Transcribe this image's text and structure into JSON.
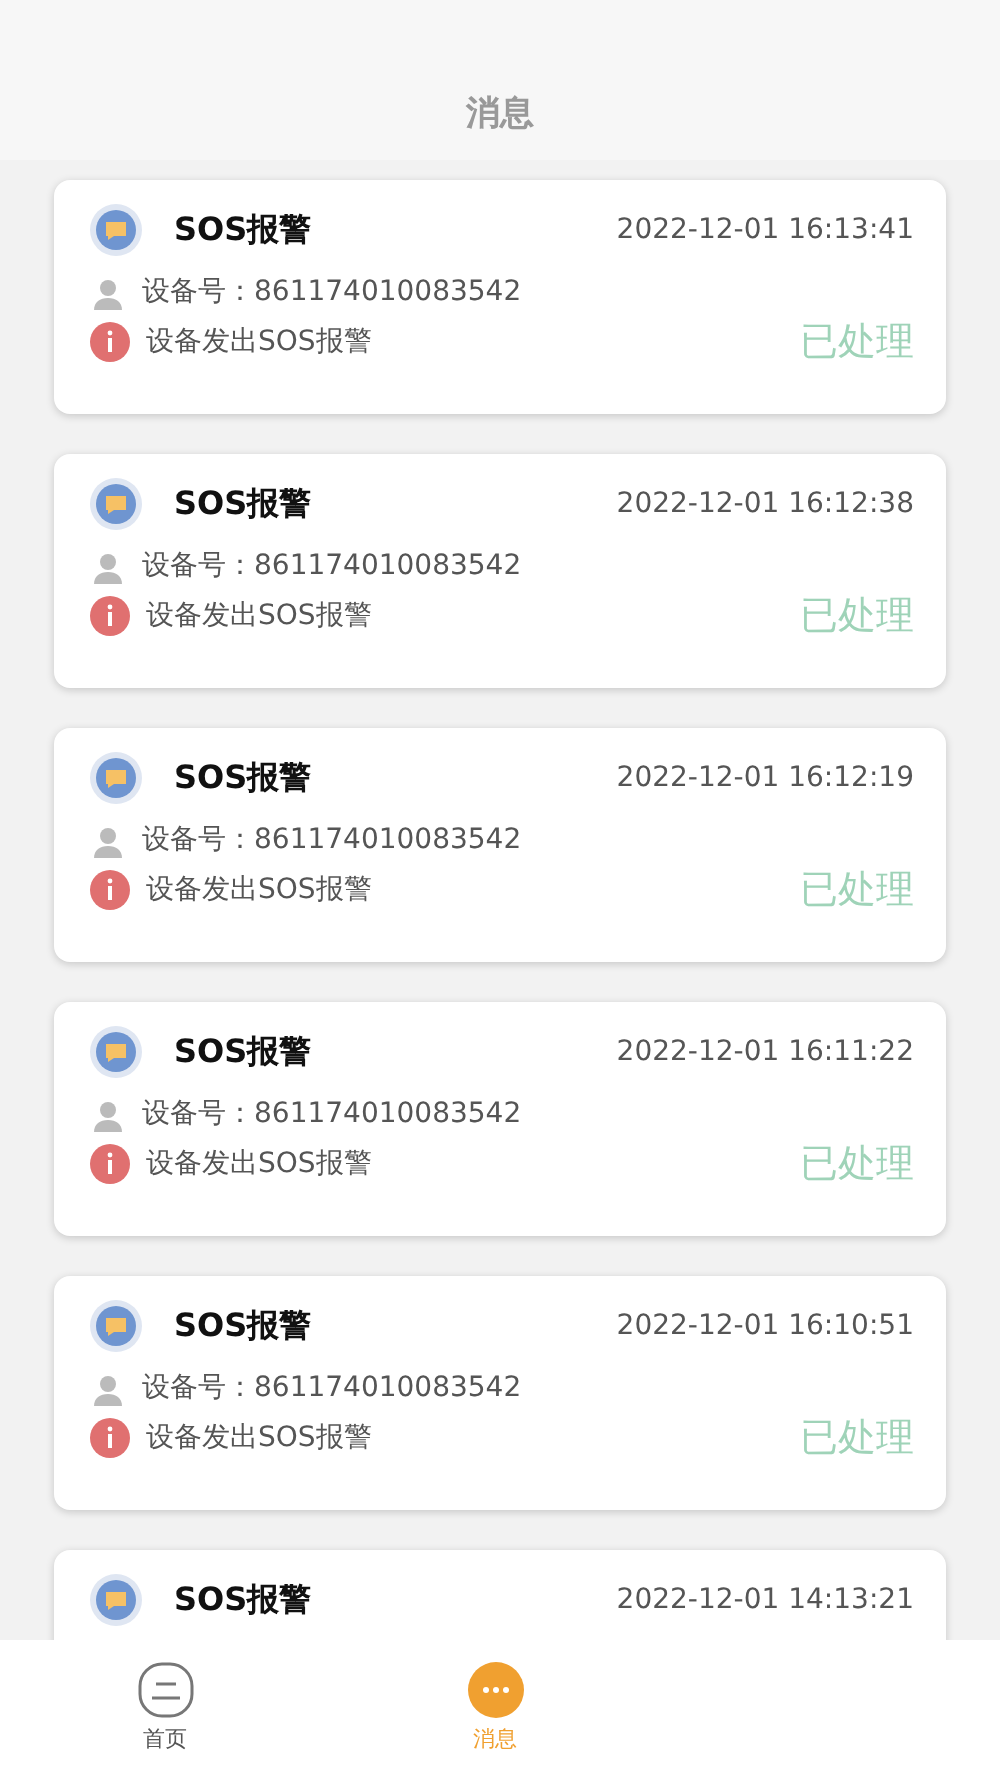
{
  "header": {
    "title": "消息"
  },
  "messages": [
    {
      "title": "SOS报警",
      "time": "2022-12-01 16:13:41",
      "device": "设备号：861174010083542",
      "description": "设备发出SOS报警",
      "status": "已处理"
    },
    {
      "title": "SOS报警",
      "time": "2022-12-01 16:12:38",
      "device": "设备号：861174010083542",
      "description": "设备发出SOS报警",
      "status": "已处理"
    },
    {
      "title": "SOS报警",
      "time": "2022-12-01 16:12:19",
      "device": "设备号：861174010083542",
      "description": "设备发出SOS报警",
      "status": "已处理"
    },
    {
      "title": "SOS报警",
      "time": "2022-12-01 16:11:22",
      "device": "设备号：861174010083542",
      "description": "设备发出SOS报警",
      "status": "已处理"
    },
    {
      "title": "SOS报警",
      "time": "2022-12-01 16:10:51",
      "device": "设备号：861174010083542",
      "description": "设备发出SOS报警",
      "status": "已处理"
    },
    {
      "title": "SOS报警",
      "time": "2022-12-01 14:13:21"
    }
  ],
  "tabs": [
    {
      "label": "首页",
      "kind": "home",
      "selected": false
    },
    {
      "label": "消息",
      "kind": "messages",
      "selected": true
    }
  ]
}
